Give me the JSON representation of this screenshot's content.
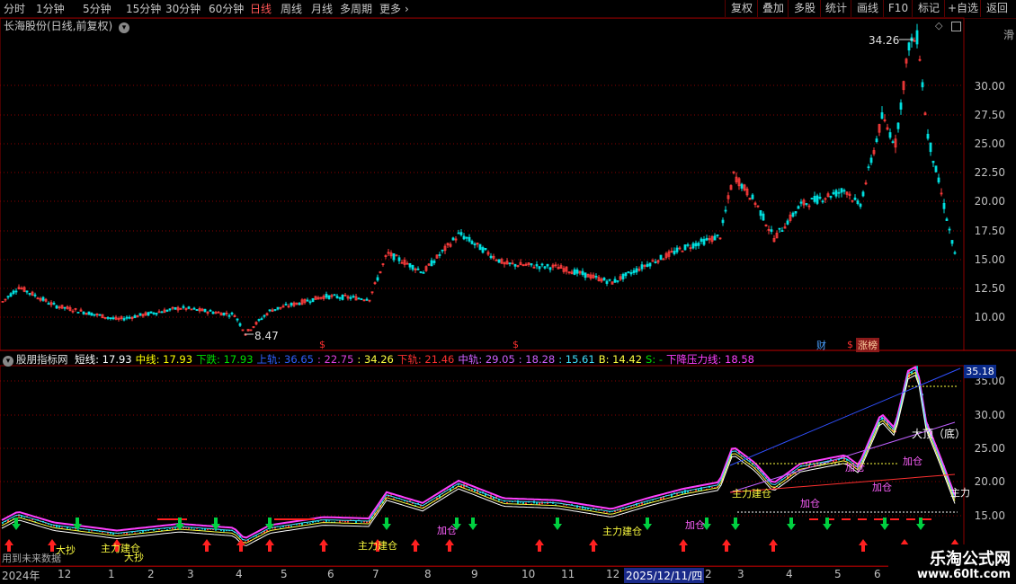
{
  "toolbar": {
    "period_tabs": [
      "分时",
      "1分钟",
      "5分钟",
      "15分钟",
      "30分钟",
      "60分钟",
      "日线",
      "周线",
      "月线",
      "多周期",
      "更多"
    ],
    "right_buttons": [
      "复权",
      "叠加",
      "多股",
      "统计",
      "画线",
      "F10",
      "标记",
      "+自选",
      "返回"
    ],
    "active_tab": "日线"
  },
  "main_pane": {
    "title": "长海股份(日线,前复权)",
    "y_ticks": [
      "30.00",
      "27.50",
      "25.00",
      "22.50",
      "20.00",
      "17.50",
      "15.00",
      "12.50",
      "10.00"
    ],
    "high_label": "34.26",
    "low_label": "8.47",
    "markers": [
      "$",
      "$",
      "$"
    ],
    "badge_cai": "财",
    "badge_zhangbang": "涨榜",
    "side_text": "滑"
  },
  "indicator": {
    "name": "股朋指标网",
    "items": [
      {
        "label": "短线:",
        "value": "17.93",
        "color": "#ffffff"
      },
      {
        "label": "中线:",
        "value": "17.93",
        "color": "#ffff00"
      },
      {
        "label": "下跌:",
        "value": "17.93",
        "color": "#00e000"
      },
      {
        "label": "上轨:",
        "value": "36.65",
        "color": "#3060ff"
      },
      {
        "label": ":",
        "value": "22.75",
        "color": "#e040e0"
      },
      {
        "label": ":",
        "value": "34.26",
        "color": "#ffff40"
      },
      {
        "label": "下轨:",
        "value": "21.46",
        "color": "#ff3030"
      },
      {
        "label": "中轨:",
        "value": "29.05",
        "color": "#d060ff"
      },
      {
        "label": ":",
        "value": "18.28",
        "color": "#d060ff"
      },
      {
        "label": ":",
        "value": "15.61",
        "color": "#40e0ff"
      },
      {
        "label": "B:",
        "value": "14.42",
        "color": "#ffff40"
      },
      {
        "label": "S:",
        "value": "-",
        "color": "#00e000"
      },
      {
        "label": "下降压力线:",
        "value": "18.58",
        "color": "#ff40ff"
      }
    ],
    "y_ticks": [
      "35.00",
      "30.00",
      "25.00",
      "20.00",
      "15.00"
    ],
    "current_value": "35.18",
    "future_note": "用到未来数据",
    "annotations": [
      "大顶（底）",
      "加仓",
      "加仓",
      "主力",
      "加仓",
      "主力建仓",
      "主力建仓",
      "大抄",
      "主力建仓",
      "大抄",
      "加仓",
      "加仓",
      "加仓",
      "主力建仓"
    ]
  },
  "date_axis": {
    "labels": [
      "2024年",
      "12",
      "1",
      "2",
      "3",
      "4",
      "5",
      "6",
      "7",
      "8",
      "9",
      "10",
      "11",
      "12",
      "2025/12/11/四",
      "2",
      "3",
      "4",
      "5",
      "6"
    ]
  },
  "watermark": {
    "title": "乐淘公式网",
    "url": "www.60lt.com"
  },
  "colors": {
    "up": "#ff3c3c",
    "down": "#00e0e0",
    "grid": "#8b0000",
    "accent_active": "#ff5555"
  }
}
